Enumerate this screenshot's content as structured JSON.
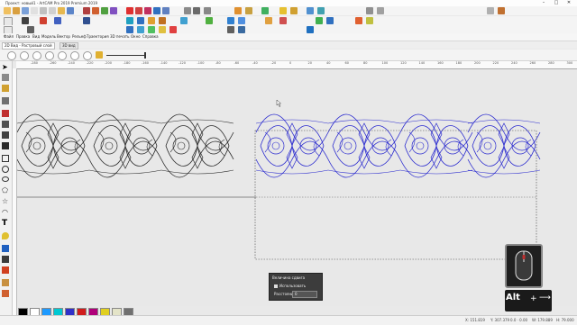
{
  "window": {
    "title": "Проект: новый1 - ArtCAM Pro 2019 Premium 2019",
    "controls": [
      "–",
      "□",
      "✕"
    ]
  },
  "menu": [
    "Файл",
    "Правка",
    "Вид",
    "Модель",
    "Вектор",
    "Рельеф",
    "Траектория",
    "3D печать",
    "Окно",
    "Справка"
  ],
  "tabs": [
    "2D Вид - Растровый слой",
    "3D вид"
  ],
  "toolbar": {
    "zoom_level": 1
  },
  "ruler_h": [
    "-280",
    "-260",
    "-240",
    "-220",
    "-200",
    "-180",
    "-160",
    "-140",
    "-120",
    "-100",
    "-80",
    "-60",
    "-40",
    "-20",
    "0",
    "20",
    "40",
    "60",
    "80",
    "100",
    "120",
    "140",
    "160",
    "180",
    "200",
    "220",
    "240",
    "260",
    "280",
    "300"
  ],
  "panel": {
    "title": "Величина сдвига",
    "use_label": "Использовать",
    "size_label": "Расстояние",
    "size_value": "0"
  },
  "keys": {
    "alt": "Alt",
    "plus": "+",
    "arrow": "⟶"
  },
  "status": {
    "coord_x": "X: 151.819",
    "coord_y": "Y: 307.379",
    "w": "0.0 ⋅ 0.00",
    "h": "W: 179.889",
    "d": "H: 79.000"
  },
  "colors": {
    "design_black": "#2a2a2a",
    "design_blue": "#2b2bcf",
    "selection": "#444"
  },
  "swatches": [
    "#000000",
    "#ffffff",
    "#1e9aff",
    "#00c8d2",
    "#3030c8",
    "#d01c1c",
    "#b0007a",
    "#e0cf20",
    "#e4e4c8",
    "#707070"
  ]
}
